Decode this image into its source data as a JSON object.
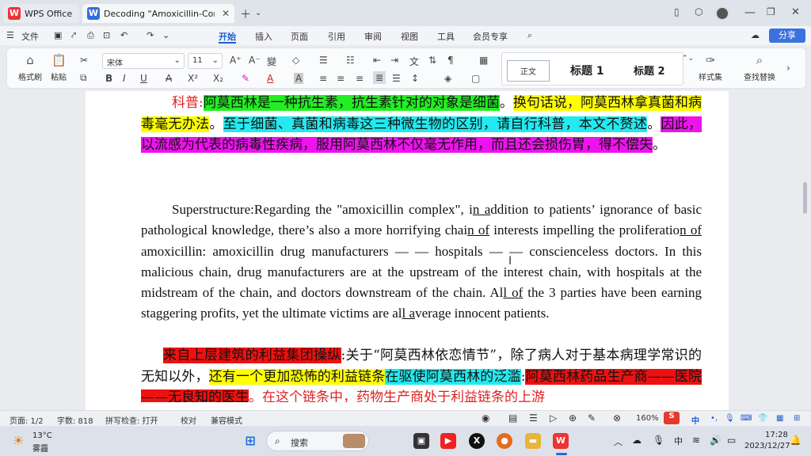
{
  "tabs": {
    "home_tab": "WPS Office",
    "doc_tab": "Decoding \"Amoxicillin-Cor"
  },
  "menu": {
    "file": "文件",
    "items": [
      "开始",
      "插入",
      "页面",
      "引用",
      "审阅",
      "视图",
      "工具",
      "会员专享"
    ],
    "share": "分享"
  },
  "ribbon": {
    "format_painter": "格式刷",
    "paste": "粘贴",
    "font_name": "宋体",
    "font_size": "11",
    "styles": [
      "正文",
      "标题 1",
      "标题 2"
    ],
    "style_set": "样式集",
    "find_replace": "查找替换"
  },
  "document": {
    "p1": {
      "label": "科普:",
      "s1": "阿莫西林是一种抗生素，抗生素针对的对象是细菌",
      "s1_end": "。",
      "s2": "换句话说，阿莫西林拿真菌和病毒毫无办法",
      "s2_end": "。",
      "s3": "至于细菌、真菌和病毒这三种微生物的区别，请自行科普，本文不赘述",
      "s3_end": "。",
      "s4": "因此，以流感为代表的病毒性疾病，服用阿莫西林不仅毫无作用，而且还会损伤胃，得不偿失",
      "s4_end": "。"
    },
    "p2": {
      "a": "Superstructure:Regarding the \"amoxicillin complex\", i",
      "b": "n a",
      "c": "ddition to patients’ ignorance of basic pathological knowledge, there’s also a more horrifying chai",
      "d": "n of",
      "e": " interests impelling the proliferatio",
      "f": "n of",
      "g": " amoxicillin: amoxicillin drug manufacturers — — hospitals — — conscienceless doctors. In this malicious chain, drug manufacturers are at the upstream of the interest chain, with hospitals at the midstream of the chain, and doctors downstream of the chain. Al",
      "h": "l of",
      "i": " the 3 parties have been earning staggering profits, yet the ultimate victims are al",
      "j": "l a",
      "k": "verage innocent patients."
    },
    "p3": {
      "r1": "来自上层建筑的利益集团操纵",
      "t1": ":关于“阿莫西林依恋情节”，除了病人对于基本病理学常识的无知以外，",
      "y1": "还有一个更加恐怖的利益链条",
      "c1": "在驱使阿莫西林的泛滥",
      "t2": ":",
      "r2": "阿莫西林药品生产商——医院——无良知的医生",
      "t3": "。在这个链条中，药物生产商处于利益链条的上游"
    }
  },
  "status": {
    "page": "页面: 1/2",
    "words": "字数: 818",
    "spell": "拼写检查: 打开",
    "proof": "校对",
    "compat": "兼容模式",
    "zoom": "160%"
  },
  "taskbar": {
    "temp": "13°C",
    "weather": "雾霾",
    "search": "搜索",
    "ime": "中",
    "time": "17:28",
    "date": "2023/12/27"
  }
}
